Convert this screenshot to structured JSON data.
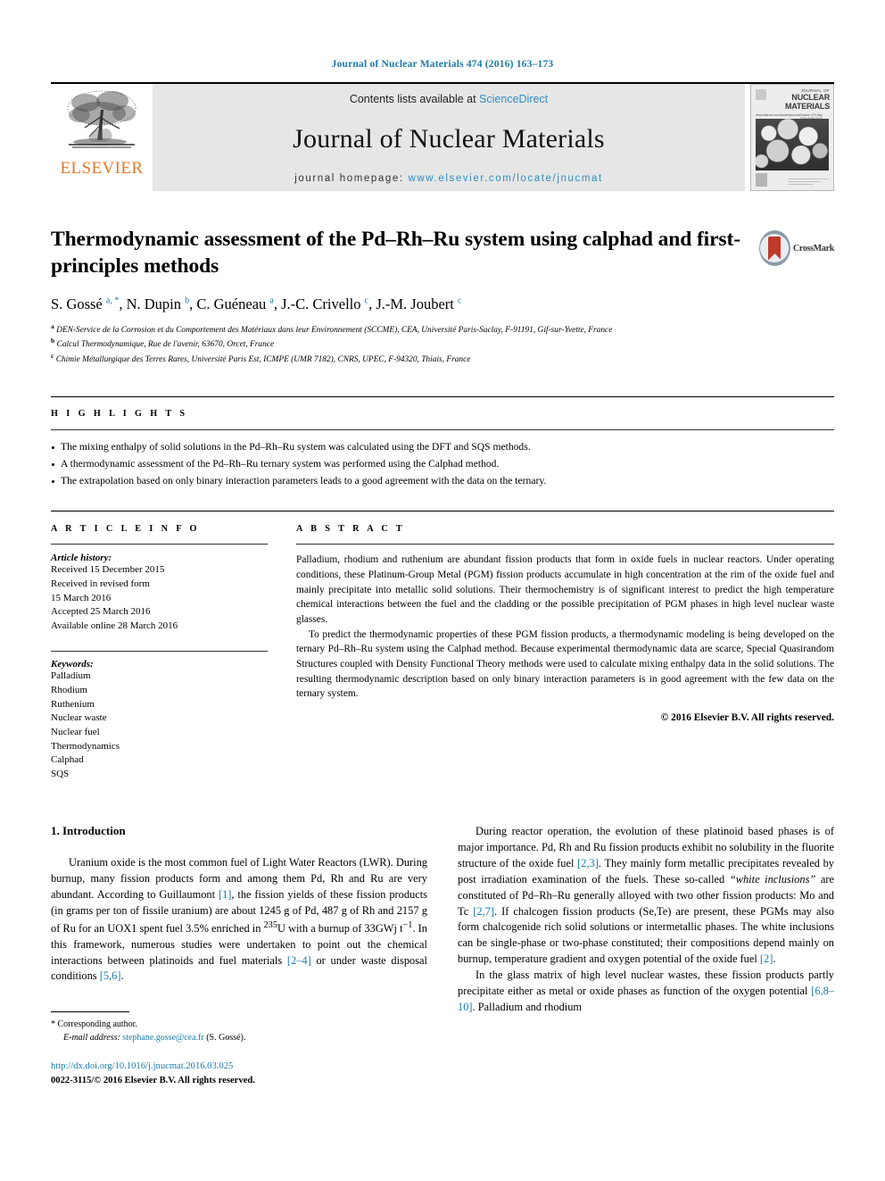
{
  "running_head": "Journal of Nuclear Materials 474 (2016) 163–173",
  "banner": {
    "contents_prefix": "Contents lists available at ",
    "sciencedirect": "ScienceDirect",
    "journal_title": "Journal of Nuclear Materials",
    "homepage_prefix": "journal homepage: ",
    "homepage_url": "www.elsevier.com/locate/jnucmat",
    "publisher": "ELSEVIER",
    "publisher_color": "#e87722",
    "link_color": "#2e8fc0"
  },
  "cover": {
    "line1": "JOURNAL OF",
    "line2": "NUCLEAR MATERIALS",
    "sub_left": "www.elsevier.com/locate/jnucmat",
    "sub_right": "Volume 474  May 2016  ISSN 0022-3115"
  },
  "article": {
    "title": "Thermodynamic assessment of the Pd–Rh–Ru system using calphad and first-principles methods",
    "crossmark_label": "CrossMark",
    "authors_html": "S. Gossé <sup>a, *</sup>, N. Dupin <sup>b</sup>, C. Guéneau <sup>a</sup>, J.-C. Crivello <sup>c</sup>, J.-M. Joubert <sup>c</sup>",
    "affiliations": [
      "DEN-Service de la Corrosion et du Comportement des Matériaux dans leur Environnement (SCCME), CEA, Université Paris-Saclay, F-91191, Gif-sur-Yvette, France",
      "Calcul Thermodynamique, Rue de l'avenir, 63670, Orcet, France",
      "Chimie Métallurgique des Terres Rares, Université Paris Est, ICMPE (UMR 7182), CNRS, UPEC, F-94320, Thiais, France"
    ],
    "affiliation_marks": [
      "a",
      "b",
      "c"
    ]
  },
  "highlights": {
    "label": "H I G H L I G H T S",
    "items": [
      "The mixing enthalpy of solid solutions in the Pd–Rh–Ru system was calculated using the DFT and SQS methods.",
      "A thermodynamic assessment of the Pd–Rh–Ru ternary system was performed using the Calphad method.",
      "The extrapolation based on only binary interaction parameters leads to a good agreement with the data on the ternary."
    ]
  },
  "article_info": {
    "label": "A R T I C L E   I N F O",
    "history_title": "Article history:",
    "history_lines": [
      "Received 15 December 2015",
      "Received in revised form",
      "15 March 2016",
      "Accepted 25 March 2016",
      "Available online 28 March 2016"
    ],
    "keywords_title": "Keywords:",
    "keywords": [
      "Palladium",
      "Rhodium",
      "Ruthenium",
      "Nuclear waste",
      "Nuclear fuel",
      "Thermodynamics",
      "Calphad",
      "SQS"
    ]
  },
  "abstract": {
    "label": "A B S T R A C T",
    "paragraph1": "Palladium, rhodium and ruthenium are abundant fission products that form in oxide fuels in nuclear reactors. Under operating conditions, these Platinum-Group Metal (PGM) fission products accumulate in high concentration at the rim of the oxide fuel and mainly precipitate into metallic solid solutions. Their thermochemistry is of significant interest to predict the high temperature chemical interactions between the fuel and the cladding or the possible precipitation of PGM phases in high level nuclear waste glasses.",
    "paragraph2": "To predict the thermodynamic properties of these PGM fission products, a thermodynamic modeling is being developed on the ternary Pd–Rh–Ru system using the Calphad method. Because experimental thermodynamic data are scarce, Special Quasirandom Structures coupled with Density Functional Theory methods were used to calculate mixing enthalpy data in the solid solutions. The resulting thermodynamic description based on only binary interaction parameters is in good agreement with the few data on the ternary system.",
    "copyright": "© 2016 Elsevier B.V. All rights reserved."
  },
  "body": {
    "section_heading": "1.  Introduction",
    "left_paragraph_html": "Uranium oxide is the most common fuel of Light Water Reactors (LWR). During burnup, many fission products form and among them Pd, Rh and Ru are very abundant. According to Guillaumont <span class=\"ref\">[1]</span>, the fission yields of these fission products (in grams per ton of fissile uranium) are about 1245 g of Pd, 487 g of Rh and 2157 g of Ru for an UOX1 spent fuel 3.5% enriched in <sup>235</sup>U with a burnup of 33GWj t<sup>&minus;1</sup>. In this framework, numerous studies were undertaken to point out the chemical interactions between platinoids and fuel materials <span class=\"ref\">[2&ndash;4]</span> or under waste disposal conditions <span class=\"ref\">[5,6]</span>.",
    "right_paragraph1_html": "During reactor operation, the evolution of these platinoid based phases is of major importance. Pd, Rh and Ru fission products exhibit no solubility in the fluorite structure of the oxide fuel <span class=\"ref\">[2,3]</span>. They mainly form metallic precipitates revealed by post irradiation examination of the fuels. These so-called <i>&ldquo;white inclusions&rdquo;</i> are constituted of Pd&ndash;Rh&ndash;Ru generally alloyed with two other fission products: Mo and Tc <span class=\"ref\">[2,7]</span>. If chalcogen fission products (Se,Te) are present, these PGMs may also form chalcogenide rich solid solutions or intermetallic phases. The white inclusions can be single-phase or two-phase constituted; their compositions depend mainly on burnup, temperature gradient and oxygen potential of the oxide fuel <span class=\"ref\">[2]</span>.",
    "right_paragraph2_html": "In the glass matrix of high level nuclear wastes, these fission products partly precipitate either as metal or oxide phases as function of the oxygen potential <span class=\"ref\">[6,8&ndash;10]</span>. Palladium and rhodium"
  },
  "footnote": {
    "star": "*",
    "corresponding": "Corresponding author.",
    "email_label": "E-mail address:",
    "email": "stephane.gosse@cea.fr",
    "email_suffix": "(S. Gossé).",
    "doi": "http://dx.doi.org/10.1016/j.jnucmat.2016.03.025",
    "issn": "0022-3115/© 2016 Elsevier B.V. All rights reserved."
  }
}
